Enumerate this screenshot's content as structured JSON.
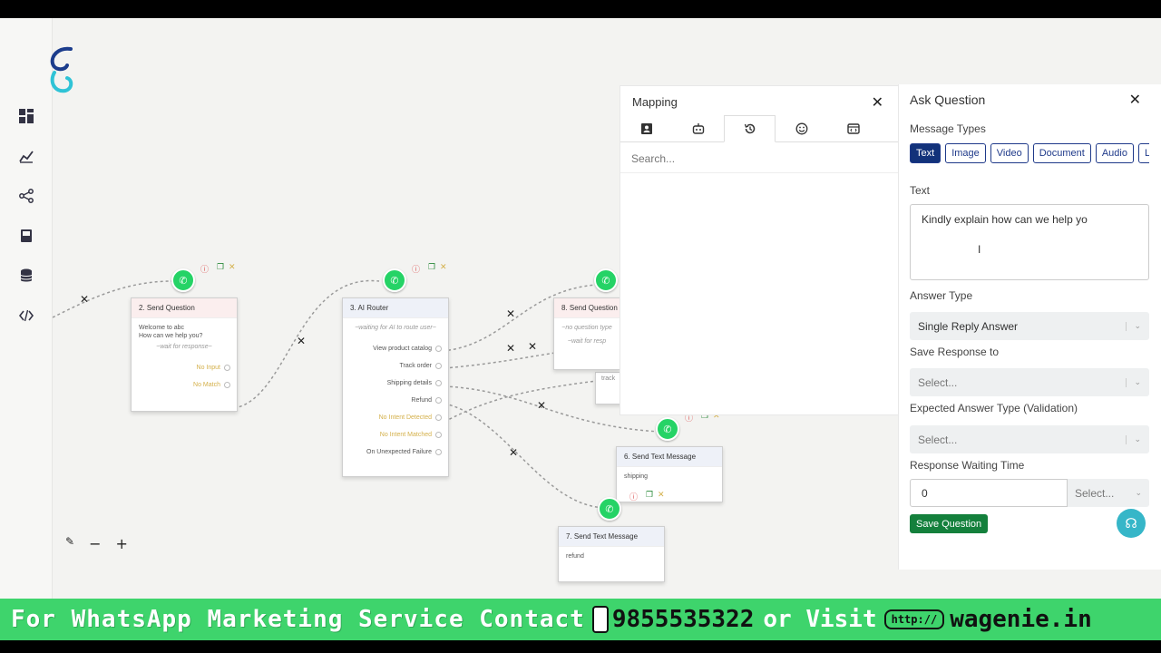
{
  "sidebar": {
    "icons": [
      "dashboard-icon",
      "analytics-icon",
      "flow-icon",
      "book-icon",
      "database-icon",
      "code-icon"
    ]
  },
  "nodes": {
    "send_question_2": {
      "title": "2. Send Question",
      "body_line1": "Welcome to abc",
      "body_line2": "How can we help you?",
      "waiting": "~wait for response~",
      "options": [
        "No Input",
        "No Match"
      ]
    },
    "ai_router_3": {
      "title": "3. AI Router",
      "waiting": "~waiting for AI to route user~",
      "options": [
        "View product catalog",
        "Track order",
        "Shipping details",
        "Refund",
        "No Intent Detected",
        "No Intent Matched",
        "On Unexpected Failure"
      ]
    },
    "send_question_8": {
      "title": "8. Send Question",
      "line1": "~no question type",
      "line2": "~wait for resp",
      "track": "track"
    },
    "send_text_6": {
      "title": "6. Send Text Message",
      "body": "shipping"
    },
    "send_text_7": {
      "title": "7. Send Text Message",
      "body": "refund"
    }
  },
  "zoom": {
    "wand": "wand-icon",
    "minus": "−",
    "plus": "+"
  },
  "mapping": {
    "title": "Mapping",
    "tabs": [
      "contact-card-icon",
      "bot-icon",
      "history-icon",
      "emoji-icon",
      "variable-icon"
    ],
    "active_tab": 2,
    "search_placeholder": "Search..."
  },
  "ask": {
    "title": "Ask Question",
    "message_types_label": "Message Types",
    "types": [
      "Text",
      "Image",
      "Video",
      "Document",
      "Audio",
      "Lo"
    ],
    "text_label": "Text",
    "text_value": "Kindly explain how can we help yo",
    "answer_type_label": "Answer Type",
    "answer_type_value": "Single Reply Answer",
    "save_response_label": "Save Response to",
    "save_response_value": "Select...",
    "expected_label": "Expected Answer Type (Validation)",
    "expected_value": "Select...",
    "waiting_label": "Response Waiting Time",
    "waiting_value": "0",
    "waiting_unit": "Select...",
    "save_button": "Save Question"
  },
  "banner": {
    "text": "For WhatsApp Marketing Service Contact",
    "phone": "9855535322",
    "or_visit": "or Visit",
    "http": "http://",
    "site": "wagenie.in"
  },
  "colors": {
    "accent": "#12327a",
    "save": "#14803c",
    "whatsapp": "#25d366",
    "banner": "#3ed46c"
  }
}
